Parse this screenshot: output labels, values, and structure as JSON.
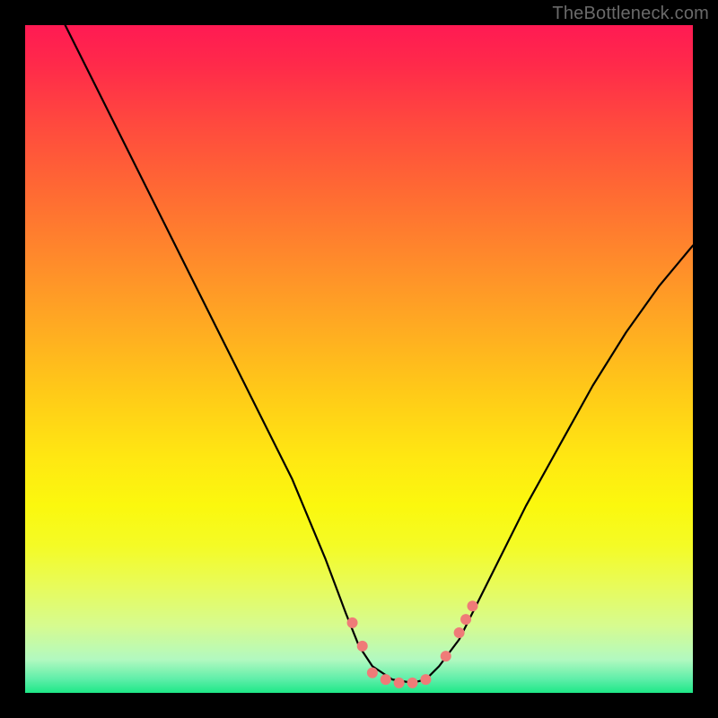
{
  "attribution": "TheBottleneck.com",
  "chart_data": {
    "type": "line",
    "title": "",
    "xlabel": "",
    "ylabel": "",
    "xlim": [
      0,
      100
    ],
    "ylim": [
      0,
      100
    ],
    "grid": false,
    "legend": false,
    "background_gradient": {
      "top": "#ff1a53",
      "bottom": "#1ee887"
    },
    "series": [
      {
        "name": "bottleneck-curve",
        "color": "#000000",
        "x": [
          6,
          10,
          15,
          20,
          25,
          30,
          35,
          40,
          45,
          48,
          50,
          52,
          55,
          58,
          60,
          62,
          65,
          70,
          75,
          80,
          85,
          90,
          95,
          100
        ],
        "y": [
          100,
          92,
          82,
          72,
          62,
          52,
          42,
          32,
          20,
          12,
          7,
          4,
          2,
          1.5,
          2,
          4,
          8,
          18,
          28,
          37,
          46,
          54,
          61,
          67
        ]
      }
    ],
    "markers": [
      {
        "x": 49.0,
        "y": 10.5,
        "color": "#ef7b78",
        "size": 12
      },
      {
        "x": 50.5,
        "y": 7.0,
        "color": "#ef7b78",
        "size": 12
      },
      {
        "x": 52.0,
        "y": 3.0,
        "color": "#ef7b78",
        "size": 12
      },
      {
        "x": 54.0,
        "y": 2.0,
        "color": "#ef7b78",
        "size": 12
      },
      {
        "x": 56.0,
        "y": 1.5,
        "color": "#ef7b78",
        "size": 12
      },
      {
        "x": 58.0,
        "y": 1.5,
        "color": "#ef7b78",
        "size": 12
      },
      {
        "x": 60.0,
        "y": 2.0,
        "color": "#ef7b78",
        "size": 12
      },
      {
        "x": 63.0,
        "y": 5.5,
        "color": "#ef7b78",
        "size": 12
      },
      {
        "x": 65.0,
        "y": 9.0,
        "color": "#ef7b78",
        "size": 12
      },
      {
        "x": 66.0,
        "y": 11.0,
        "color": "#ef7b78",
        "size": 12
      },
      {
        "x": 67.0,
        "y": 13.0,
        "color": "#ef7b78",
        "size": 12
      }
    ]
  }
}
